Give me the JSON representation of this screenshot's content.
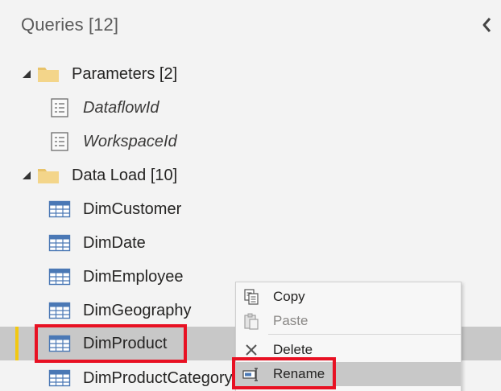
{
  "pane": {
    "title": "Queries [12]",
    "collapse_icon": "chevron-left-icon"
  },
  "tree": {
    "groups": [
      {
        "label": "Parameters [2]",
        "icon": "folder-icon",
        "expanded": true,
        "items": [
          {
            "label": "DataflowId",
            "icon": "parameter-icon"
          },
          {
            "label": "WorkspaceId",
            "icon": "parameter-icon"
          }
        ]
      },
      {
        "label": "Data Load [10]",
        "icon": "folder-icon",
        "expanded": true,
        "items": [
          {
            "label": "DimCustomer",
            "icon": "table-icon"
          },
          {
            "label": "DimDate",
            "icon": "table-icon"
          },
          {
            "label": "DimEmployee",
            "icon": "table-icon"
          },
          {
            "label": "DimGeography",
            "icon": "table-icon"
          },
          {
            "label": "DimProduct",
            "icon": "table-icon",
            "selected": true
          },
          {
            "label": "DimProductCategory",
            "icon": "table-icon"
          }
        ]
      }
    ]
  },
  "context_menu": {
    "items": [
      {
        "label": "Copy",
        "icon": "copy-icon",
        "enabled": true
      },
      {
        "label": "Paste",
        "icon": "paste-icon",
        "enabled": false
      },
      {
        "label": "Delete",
        "icon": "delete-icon",
        "enabled": true
      },
      {
        "label": "Rename",
        "icon": "rename-icon",
        "enabled": true,
        "hover": true
      }
    ]
  },
  "colors": {
    "selection_indicator": "#f2c811",
    "highlight_border": "#e81123",
    "folder": "#f3d58a",
    "table_icon": "#4a78b5"
  }
}
